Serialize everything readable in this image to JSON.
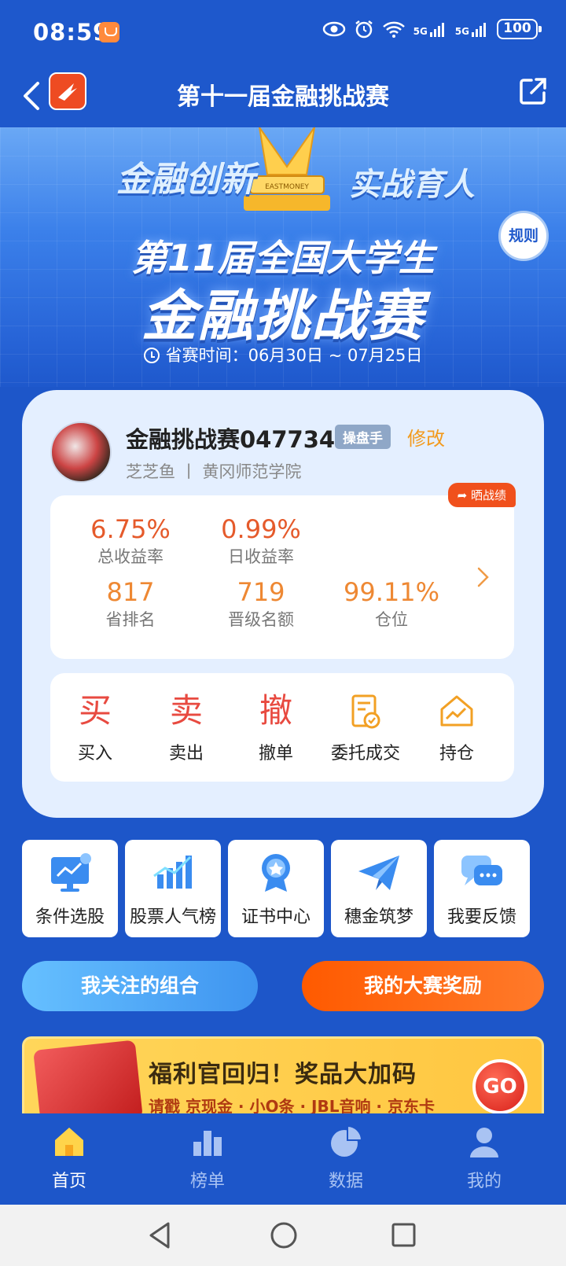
{
  "status_bar": {
    "time": "08:59",
    "battery": "100",
    "network_1": "5G",
    "network_2": "5G"
  },
  "nav": {
    "title": "第十一届金融挑战赛"
  },
  "banner": {
    "tag_left": "金融创新",
    "tag_right": "实战育人",
    "trophy_text": "EASTMONEY",
    "line1": "第11届全国大学生",
    "line2": "金融挑战赛",
    "period": "省赛时间：06月30日 ~ 07月25日",
    "rules_label": "规则"
  },
  "profile": {
    "username": "金融挑战赛047734",
    "level_badge": "操盘手",
    "edit_label": "修改",
    "school": "芝芝鱼 丨 黄冈师范学院"
  },
  "stats": {
    "share_label": "晒战绩",
    "items": [
      {
        "value": "6.75%",
        "label": "总收益率"
      },
      {
        "value": "0.99%",
        "label": "日收益率"
      },
      {
        "value": "817",
        "label": "省排名"
      },
      {
        "value": "719",
        "label": "晋级名额"
      },
      {
        "value": "99.11%",
        "label": "仓位"
      }
    ]
  },
  "actions": [
    {
      "glyph": "买",
      "label": "买入"
    },
    {
      "glyph": "卖",
      "label": "卖出"
    },
    {
      "glyph": "撤",
      "label": "撤单"
    },
    {
      "icon": "order-check-icon",
      "label": "委托成交"
    },
    {
      "icon": "holdings-icon",
      "label": "持仓"
    }
  ],
  "tools": [
    {
      "icon": "monitor-icon",
      "label": "条件选股"
    },
    {
      "icon": "bar-chart-icon",
      "label": "股票人气榜"
    },
    {
      "icon": "medal-icon",
      "label": "证书中心"
    },
    {
      "icon": "paper-plane-icon",
      "label": "穗金筑梦"
    },
    {
      "icon": "chat-icon",
      "label": "我要反馈"
    }
  ],
  "buttons": {
    "followed": "我关注的组合",
    "rewards": "我的大赛奖励"
  },
  "promo": {
    "headline": "福利官回归！奖品大加码",
    "sub": "请戳 京现金 · 小O条 · JBL音响 · 京东卡",
    "go": "GO"
  },
  "tabbar": [
    {
      "icon": "home-icon",
      "label": "首页"
    },
    {
      "icon": "ranking-icon",
      "label": "榜单"
    },
    {
      "icon": "pie-icon",
      "label": "数据"
    },
    {
      "icon": "user-icon",
      "label": "我的"
    }
  ],
  "colors": {
    "primary": "#1d56c9",
    "accent_orange": "#ff5a00",
    "gain_red": "#e55a2b"
  }
}
